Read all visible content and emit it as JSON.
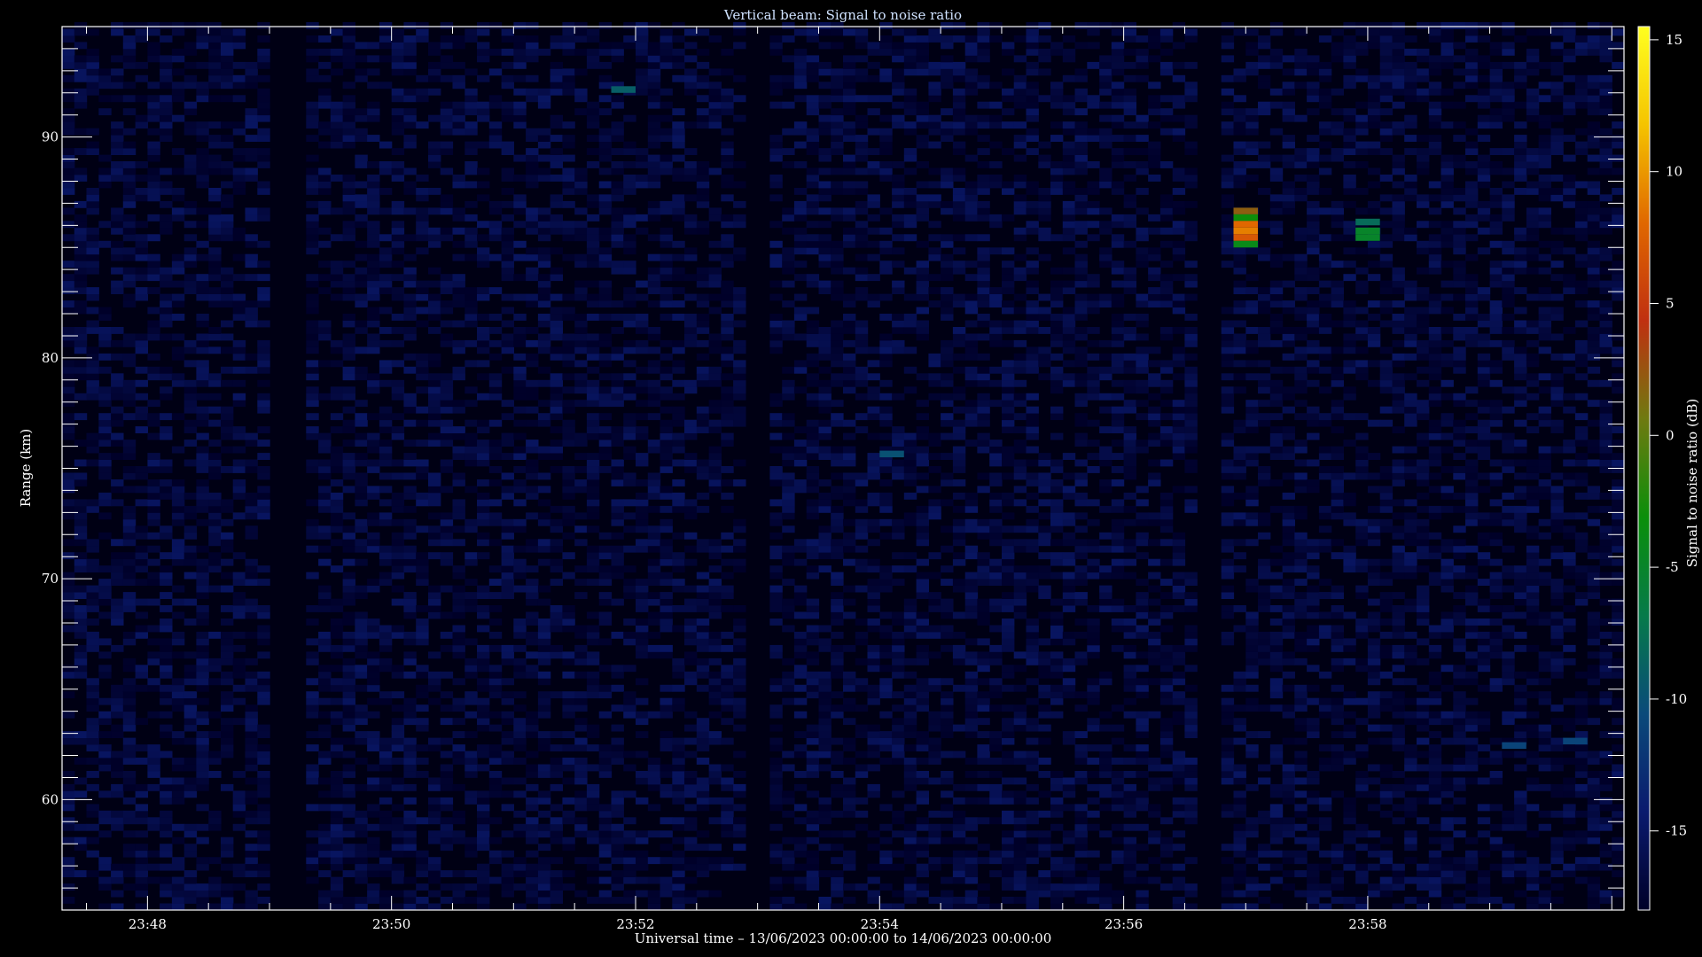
{
  "chart_data": {
    "type": "heatmap",
    "title": "Vertical beam: Signal to noise ratio",
    "xlabel": "Universal time – 13/06/2023 00:00:00 to 14/06/2023 00:00:00",
    "ylabel": "Range (km)",
    "colorbar_label": "Signal to noise ratio (dB)",
    "x_tick_labels": [
      "23:48",
      "23:50",
      "23:52",
      "23:54",
      "23:56",
      "23:58"
    ],
    "x_tick_minutes": [
      48,
      50,
      52,
      54,
      56,
      58
    ],
    "xlim_minutes": [
      47.3,
      60.1
    ],
    "y_ticks": [
      60,
      70,
      80,
      90
    ],
    "ylim": [
      55,
      95
    ],
    "colorbar_ticks": [
      15,
      10,
      5,
      0,
      -5,
      -10,
      -15
    ],
    "colorbar_range": [
      -18,
      15.5
    ],
    "background_db": -18,
    "noise_db_range": [
      -18,
      -15
    ],
    "highlights": [
      {
        "time_minute": 57.0,
        "range_km": 86.5,
        "snr_db": 2
      },
      {
        "time_minute": 57.0,
        "range_km": 86.2,
        "snr_db": -3
      },
      {
        "time_minute": 57.0,
        "range_km": 85.9,
        "snr_db": 8
      },
      {
        "time_minute": 57.0,
        "range_km": 85.6,
        "snr_db": 9
      },
      {
        "time_minute": 57.0,
        "range_km": 85.3,
        "snr_db": 7
      },
      {
        "time_minute": 57.0,
        "range_km": 85.0,
        "snr_db": -4
      },
      {
        "time_minute": 58.0,
        "range_km": 86.0,
        "snr_db": -8
      },
      {
        "time_minute": 58.0,
        "range_km": 85.6,
        "snr_db": -5
      },
      {
        "time_minute": 58.0,
        "range_km": 85.3,
        "snr_db": -5
      },
      {
        "time_minute": 51.9,
        "range_km": 92.0,
        "snr_db": -9
      },
      {
        "time_minute": 54.1,
        "range_km": 75.5,
        "snr_db": -10
      },
      {
        "time_minute": 59.7,
        "range_km": 62.5,
        "snr_db": -11
      },
      {
        "time_minute": 59.2,
        "range_km": 62.3,
        "snr_db": -11
      }
    ],
    "data_gaps_minutes": [
      [
        49.0,
        49.3
      ],
      [
        52.9,
        53.1
      ],
      [
        56.6,
        56.8
      ]
    ],
    "grid": false,
    "colors": {
      "axes": "#ffffff",
      "title": "#cfe2ff",
      "colormap": [
        "#000028",
        "#0a1a6e",
        "#0a4a7a",
        "#067a4a",
        "#0a8f0a",
        "#6f7a10",
        "#c03010",
        "#e06800",
        "#f5c400",
        "#ffff20"
      ]
    }
  }
}
